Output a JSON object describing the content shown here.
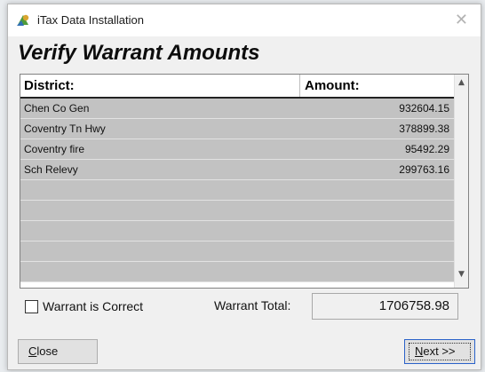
{
  "window": {
    "title": "iTax Data Installation",
    "close_glyph": "✕",
    "app_icon": "tax-app-icon"
  },
  "heading": "Verify Warrant Amounts",
  "grid": {
    "columns": [
      "District:",
      "Amount:"
    ],
    "rows": [
      {
        "district": "Chen Co Gen",
        "amount": "932604.15"
      },
      {
        "district": "Coventry Tn Hwy",
        "amount": "378899.38"
      },
      {
        "district": "Coventry fire",
        "amount": "95492.29"
      },
      {
        "district": "Sch Relevy",
        "amount": "299763.16"
      }
    ],
    "empty_rows": 5,
    "scroll_up_glyph": "▲",
    "scroll_down_glyph": "▼"
  },
  "checkbox": {
    "label": "Warrant is Correct",
    "checked": false
  },
  "total": {
    "label": "Warrant Total:",
    "value": "1706758.98"
  },
  "buttons": {
    "close_mnemonic": "C",
    "close_rest": "lose",
    "next_mnemonic": "N",
    "next_rest": "ext >>"
  },
  "colors": {
    "row_bg": "#c2c2c2",
    "focus_border": "#2a62c9"
  }
}
